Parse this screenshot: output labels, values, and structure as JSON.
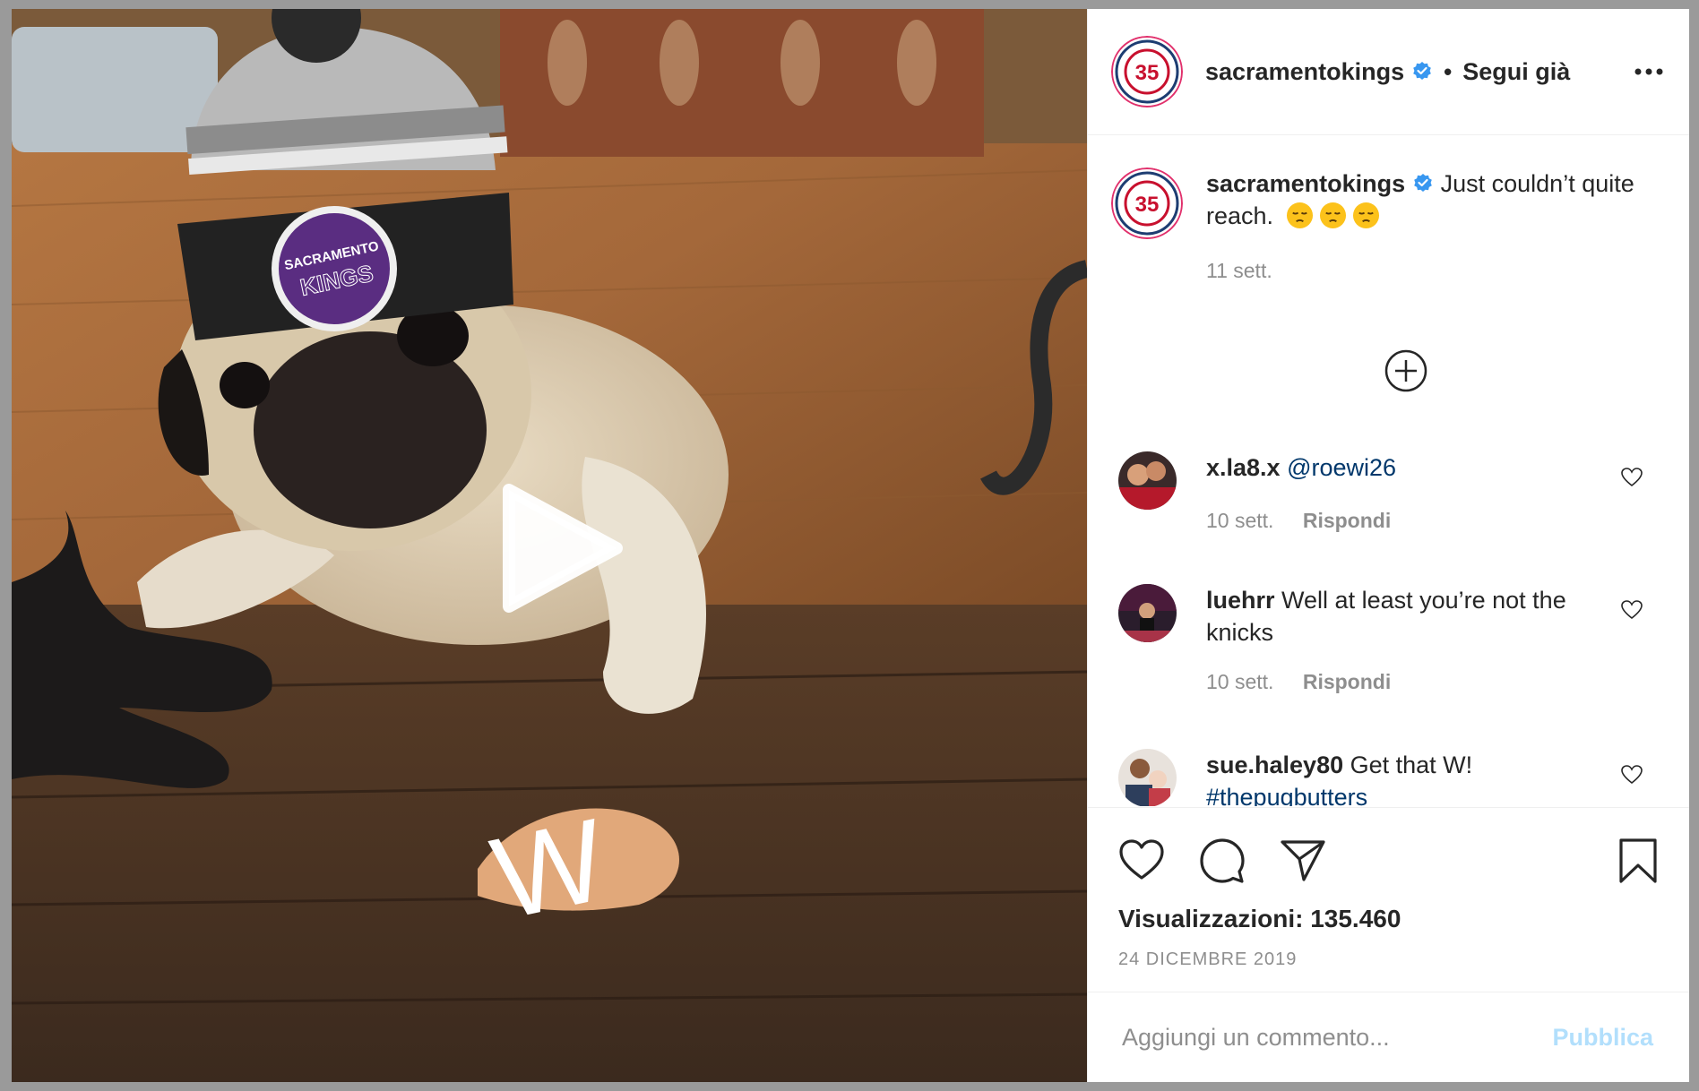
{
  "post": {
    "author": "sacramentokings",
    "follow_status": "Segui già",
    "separator": "•",
    "caption": "Just couldn’t quite reach.",
    "caption_time": "11 sett.",
    "views_label": "Visualizzazioni: 135.460",
    "date": "24 DICEMBRE 2019",
    "video_overlay_letter": "W",
    "hat_text": [
      "SACRAMENTO",
      "KINGS"
    ],
    "avatar_badge_text": "35"
  },
  "comments": [
    {
      "user": "x.la8.x",
      "text": "@roewi26",
      "time": "10 sett.",
      "reply": "Rispondi"
    },
    {
      "user": "luehrr",
      "text": "Well at least you’re not the knicks",
      "time": "10 sett.",
      "reply": "Rispondi"
    },
    {
      "user": "sue.haley80",
      "text": "Get that W!",
      "hashtag": "#thepugbutters"
    }
  ],
  "composer": {
    "placeholder": "Aggiungi un commento...",
    "publish_label": "Pubblica"
  },
  "icons": {
    "verified": "verified-badge-icon",
    "more": "more-options-icon",
    "load_more": "plus-circle-icon",
    "like": "heart-icon",
    "comment": "comment-bubble-icon",
    "share": "paper-plane-icon",
    "save": "bookmark-icon",
    "play": "play-icon",
    "emoji": "pensive-face-emoji"
  },
  "colors": {
    "verified_blue": "#3897f0",
    "link_blue": "#00376b",
    "publish_disabled": "#b2dffc",
    "muted_text": "#8e8e8e",
    "kings_purple": "#5a2d81"
  }
}
